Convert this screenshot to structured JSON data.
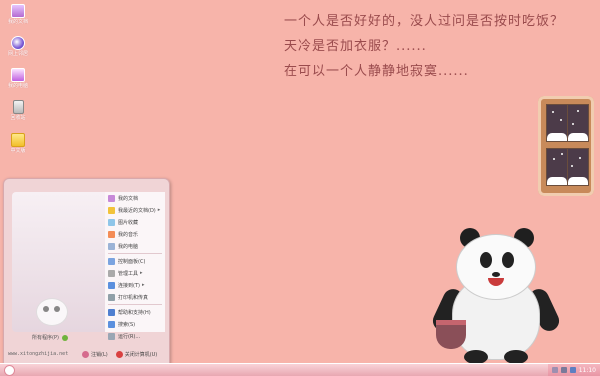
{
  "desktop": {
    "icons": [
      {
        "label": "我的文档",
        "icon": "documents-icon"
      },
      {
        "label": "网上邻居",
        "icon": "network-icon"
      },
      {
        "label": "我的电脑",
        "icon": "computer-icon"
      },
      {
        "label": "回收站",
        "icon": "recycle-bin-icon"
      },
      {
        "label": "中文版",
        "icon": "folder-icon"
      }
    ],
    "quote_lines": [
      "一个人是否好好的，没人过问是否按时吃饭？",
      "天冷是否加衣服？......",
      "在可以一个人静静地寂寞......"
    ]
  },
  "start_menu": {
    "right_items": [
      {
        "label": "我的文档",
        "icon": "documents-icon",
        "arrow": false
      },
      {
        "label": "我最近的文档(D)",
        "icon": "recent-docs-icon",
        "arrow": true
      },
      {
        "label": "图片收藏",
        "icon": "pictures-icon",
        "arrow": false
      },
      {
        "label": "我的音乐",
        "icon": "music-icon",
        "arrow": false
      },
      {
        "label": "我的电脑",
        "icon": "computer-icon",
        "arrow": false
      },
      {
        "label": "控制面板(C)",
        "icon": "control-panel-icon",
        "arrow": false
      },
      {
        "label": "管理工具",
        "icon": "admin-tools-icon",
        "arrow": true
      },
      {
        "label": "连接到(T)",
        "icon": "connect-icon",
        "arrow": true
      },
      {
        "label": "打印机和传真",
        "icon": "printer-icon",
        "arrow": false
      },
      {
        "label": "帮助和支持(H)",
        "icon": "help-icon",
        "arrow": false
      },
      {
        "label": "搜索(S)",
        "icon": "search-icon",
        "arrow": false
      },
      {
        "label": "运行(R)...",
        "icon": "run-icon",
        "arrow": false
      }
    ],
    "all_programs": "所有程序(P)",
    "site": "www.xitongzhijia.net",
    "logoff": "注销(L)",
    "shutdown": "关闭计算机(U)"
  },
  "taskbar": {
    "clock": "11:10",
    "tray_icons": [
      "language-icon",
      "volume-icon",
      "network-icon"
    ]
  },
  "colors": {
    "desktop_bg": "#f7b4aa",
    "quote_text": "#9a4b4d",
    "taskbar": "#e8a7b1"
  }
}
